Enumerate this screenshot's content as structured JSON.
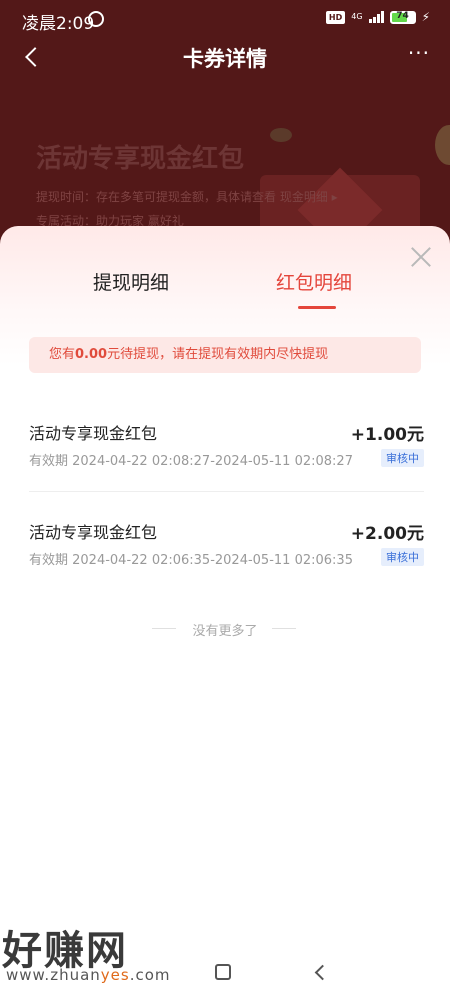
{
  "status_bar": {
    "time": "凌晨2:09",
    "hd": "HD",
    "network": "4G",
    "battery": "74",
    "battery_level": 0.74
  },
  "header": {
    "title": "卡券详情",
    "more_label": "···"
  },
  "background": {
    "coupon_title": "活动专享现金红包",
    "line1": "提现时间：存在多笔可提现金额，具体请查看 现金明细 ▸",
    "line2": "专属活动：助力玩家 赢好礼"
  },
  "tabs": [
    {
      "label": "提现明细",
      "active": false
    },
    {
      "label": "红包明细",
      "active": true
    }
  ],
  "notice": {
    "prefix": "您有",
    "amount": "0.00",
    "suffix": "元待提现，请在提现有效期内尽快提现"
  },
  "items": [
    {
      "title": "活动专享现金红包",
      "amount": "+1.00元",
      "validity": "有效期 2024-04-22 02:08:27-2024-05-11 02:08:27",
      "status": "审核中"
    },
    {
      "title": "活动专享现金红包",
      "amount": "+2.00元",
      "validity": "有效期 2024-04-22 02:06:35-2024-05-11 02:06:35",
      "status": "审核中"
    }
  ],
  "no_more": "没有更多了",
  "watermark": {
    "brand": "好赚网",
    "url_prefix": "www.zhuan",
    "url_highlight": "yes",
    "url_suffix": ".com"
  },
  "colors": {
    "accent": "#e4453b",
    "header_bg": "#531818",
    "status_blue": "#3a6fd8"
  }
}
